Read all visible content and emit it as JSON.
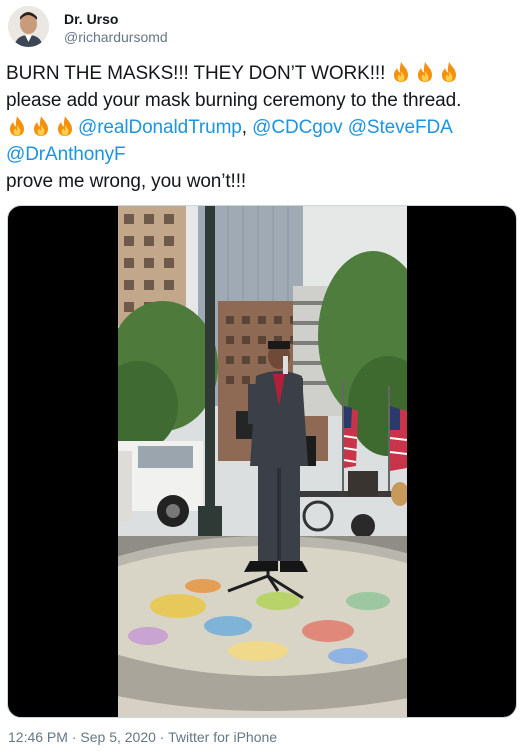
{
  "author": {
    "name": "Dr. Urso",
    "handle": "@richardursomd"
  },
  "tweet": {
    "line1_text": "BURN THE MASKS!!! THEY DON’T WORK!!! ",
    "line2_text": "please add your mask burning ceremony to the thread.",
    "mention_trump": "@realDonaldTrump",
    "sep_comma": ", ",
    "mention_cdc": "@CDCgov",
    "sep_space": " ",
    "mention_fda": "@SteveFDA",
    "mention_fauci": "@DrAnthonyF",
    "line5_text": "prove me wrong, you won’t!!!"
  },
  "icons": {
    "fire": "fire-emoji"
  },
  "footer": {
    "time": "12:46 PM",
    "dot1": " · ",
    "date": "Sep 5, 2020",
    "dot2": " · ",
    "source": "Twitter for iPhone"
  },
  "colors": {
    "mention": "#1b95e0",
    "secondary_text": "#657786",
    "primary_text": "#14171a"
  }
}
